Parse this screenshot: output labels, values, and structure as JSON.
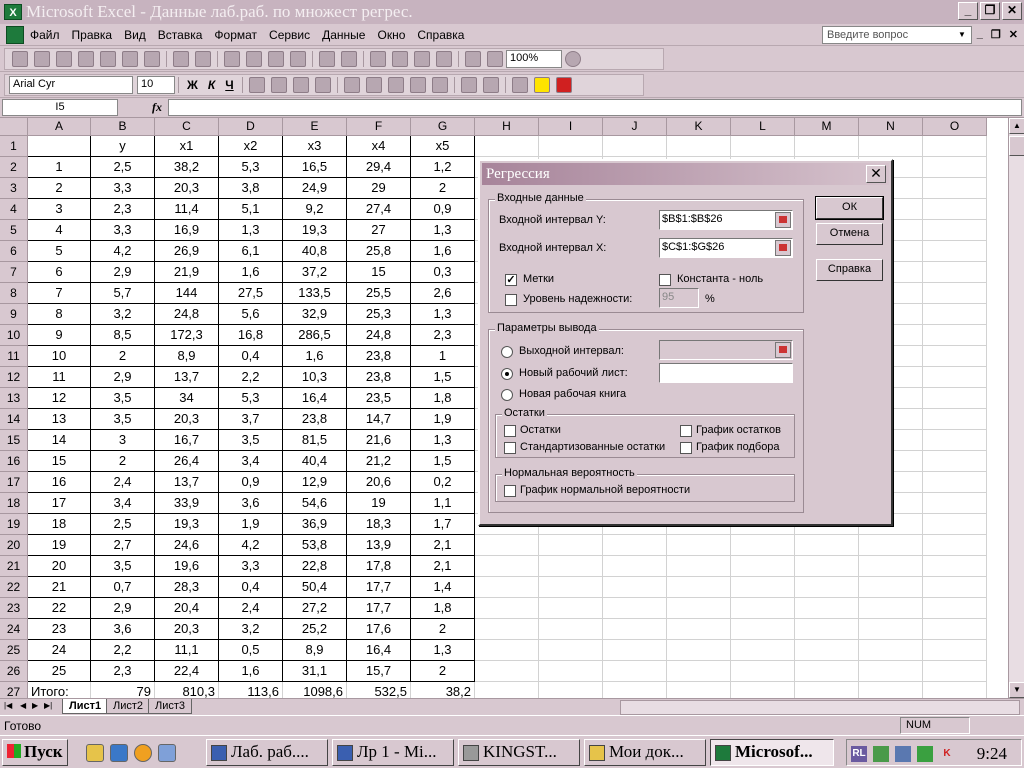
{
  "window": {
    "title": "Microsoft Excel - Данные лаб.раб. по множест регрес."
  },
  "menu": [
    "Файл",
    "Правка",
    "Вид",
    "Вставка",
    "Формат",
    "Сервис",
    "Данные",
    "Окно",
    "Справка"
  ],
  "ask_placeholder": "Введите вопрос",
  "toolbar": {
    "zoom": "100%",
    "font_name": "Arial Cyr",
    "font_size": "10",
    "bold": "Ж",
    "italic": "К",
    "underline": "Ч"
  },
  "formula_bar": {
    "name_box": "I5",
    "fx": "fx",
    "value": ""
  },
  "columns": [
    "A",
    "B",
    "C",
    "D",
    "E",
    "F",
    "G",
    "H",
    "I",
    "J",
    "K",
    "L",
    "M",
    "N",
    "O"
  ],
  "rows": [
    [
      "",
      "y",
      "x1",
      "x2",
      "x3",
      "x4",
      "x5"
    ],
    [
      "1",
      "2,5",
      "38,2",
      "5,3",
      "16,5",
      "29,4",
      "1,2"
    ],
    [
      "2",
      "3,3",
      "20,3",
      "3,8",
      "24,9",
      "29",
      "2"
    ],
    [
      "3",
      "2,3",
      "11,4",
      "5,1",
      "9,2",
      "27,4",
      "0,9"
    ],
    [
      "4",
      "3,3",
      "16,9",
      "1,3",
      "19,3",
      "27",
      "1,3"
    ],
    [
      "5",
      "4,2",
      "26,9",
      "6,1",
      "40,8",
      "25,8",
      "1,6"
    ],
    [
      "6",
      "2,9",
      "21,9",
      "1,6",
      "37,2",
      "15",
      "0,3"
    ],
    [
      "7",
      "5,7",
      "144",
      "27,5",
      "133,5",
      "25,5",
      "2,6"
    ],
    [
      "8",
      "3,2",
      "24,8",
      "5,6",
      "32,9",
      "25,3",
      "1,3"
    ],
    [
      "9",
      "8,5",
      "172,3",
      "16,8",
      "286,5",
      "24,8",
      "2,3"
    ],
    [
      "10",
      "2",
      "8,9",
      "0,4",
      "1,6",
      "23,8",
      "1"
    ],
    [
      "11",
      "2,9",
      "13,7",
      "2,2",
      "10,3",
      "23,8",
      "1,5"
    ],
    [
      "12",
      "3,5",
      "34",
      "5,3",
      "16,4",
      "23,5",
      "1,8"
    ],
    [
      "13",
      "3,5",
      "20,3",
      "3,7",
      "23,8",
      "14,7",
      "1,9"
    ],
    [
      "14",
      "3",
      "16,7",
      "3,5",
      "81,5",
      "21,6",
      "1,3"
    ],
    [
      "15",
      "2",
      "26,4",
      "3,4",
      "40,4",
      "21,2",
      "1,5"
    ],
    [
      "16",
      "2,4",
      "13,7",
      "0,9",
      "12,9",
      "20,6",
      "0,2"
    ],
    [
      "17",
      "3,4",
      "33,9",
      "3,6",
      "54,6",
      "19",
      "1,1"
    ],
    [
      "18",
      "2,5",
      "19,3",
      "1,9",
      "36,9",
      "18,3",
      "1,7"
    ],
    [
      "19",
      "2,7",
      "24,6",
      "4,2",
      "53,8",
      "13,9",
      "2,1"
    ],
    [
      "20",
      "3,5",
      "19,6",
      "3,3",
      "22,8",
      "17,8",
      "2,1"
    ],
    [
      "21",
      "0,7",
      "28,3",
      "0,4",
      "50,4",
      "17,7",
      "1,4"
    ],
    [
      "22",
      "2,9",
      "20,4",
      "2,4",
      "27,2",
      "17,7",
      "1,8"
    ],
    [
      "23",
      "3,6",
      "20,3",
      "3,2",
      "25,2",
      "17,6",
      "2"
    ],
    [
      "24",
      "2,2",
      "11,1",
      "0,5",
      "8,9",
      "16,4",
      "1,3"
    ],
    [
      "25",
      "2,3",
      "22,4",
      "1,6",
      "31,1",
      "15,7",
      "2"
    ],
    [
      "Итого:",
      "79",
      "810,3",
      "113,6",
      "1098,6",
      "532,5",
      "38,2"
    ]
  ],
  "sheet_tabs": [
    "Лист1",
    "Лист2",
    "Лист3"
  ],
  "status": {
    "ready": "Готово",
    "num": "NUM"
  },
  "dialog": {
    "title": "Регрессия",
    "close": "✕",
    "input_group": "Входные данные",
    "input_y_label": "Входной интервал Y:",
    "input_y_value": "$B$1:$B$26",
    "input_x_label": "Входной интервал X:",
    "input_x_value": "$C$1:$G$26",
    "labels": "Метки",
    "constant_zero": "Константа - ноль",
    "confidence": "Уровень надежности:",
    "confidence_value": "95",
    "percent": "%",
    "output_group": "Параметры вывода",
    "output_range": "Выходной интервал:",
    "new_sheet": "Новый рабочий лист:",
    "new_book": "Новая рабочая книга",
    "residuals_group": "Остатки",
    "residuals": "Остатки",
    "std_residuals": "Стандартизованные остатки",
    "residual_plot": "График остатков",
    "fit_plot": "График подбора",
    "normal_group": "Нормальная вероятность",
    "normal_plot": "График нормальной вероятности",
    "ok": "ОК",
    "cancel": "Отмена",
    "help": "Справка",
    "checkmark": "✓"
  },
  "taskbar": {
    "start": "Пуск",
    "tasks": [
      "Лаб. раб....",
      "Лр 1 - Mi...",
      "KINGST...",
      "Мои док...",
      "Microsof..."
    ],
    "clock": "9:24",
    "tray_lang": "RL"
  }
}
